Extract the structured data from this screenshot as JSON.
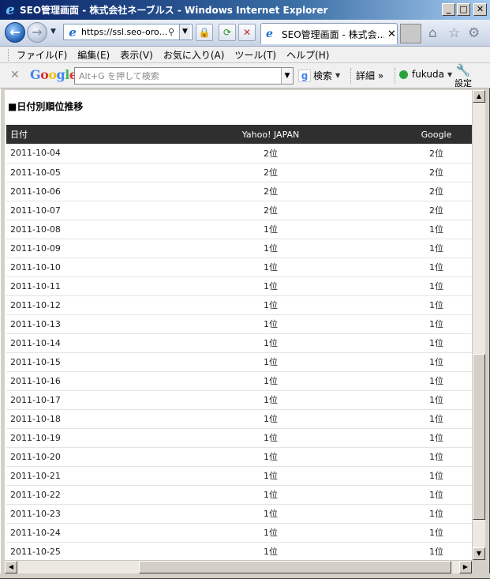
{
  "window": {
    "title": "SEO管理画面 - 株式会社ネーブルス - Windows Internet Explorer",
    "logo_icon": "ie-logo-icon",
    "controls": {
      "minimize": "_",
      "maximize": "□",
      "close": "✕"
    }
  },
  "address": {
    "url": "https://ssl.seo-oro...",
    "lock_icon": "lock-icon",
    "refresh_icon": "refresh-icon",
    "stop_icon": "stop-icon"
  },
  "tab": {
    "title": "SEO管理画面 - 株式会...",
    "close": "✕"
  },
  "menu": [
    "ファイル(F)",
    "編集(E)",
    "表示(V)",
    "お気に入り(A)",
    "ツール(T)",
    "ヘルプ(H)"
  ],
  "google_toolbar": {
    "logo": "Google",
    "search_placeholder": "Alt+G を押して検索",
    "search_button": "検索",
    "details": "詳細 »",
    "user": "fukuda",
    "settings": "設定"
  },
  "page": {
    "section_title": "■日付別順位推移",
    "table": {
      "headers": {
        "date": "日付",
        "yahoo": "Yahoo! JAPAN",
        "google": "Google"
      },
      "rows": [
        {
          "date": "2011-10-04",
          "yahoo": "2位",
          "google": "2位"
        },
        {
          "date": "2011-10-05",
          "yahoo": "2位",
          "google": "2位"
        },
        {
          "date": "2011-10-06",
          "yahoo": "2位",
          "google": "2位"
        },
        {
          "date": "2011-10-07",
          "yahoo": "2位",
          "google": "2位"
        },
        {
          "date": "2011-10-08",
          "yahoo": "1位",
          "google": "1位"
        },
        {
          "date": "2011-10-09",
          "yahoo": "1位",
          "google": "1位"
        },
        {
          "date": "2011-10-10",
          "yahoo": "1位",
          "google": "1位"
        },
        {
          "date": "2011-10-11",
          "yahoo": "1位",
          "google": "1位"
        },
        {
          "date": "2011-10-12",
          "yahoo": "1位",
          "google": "1位"
        },
        {
          "date": "2011-10-13",
          "yahoo": "1位",
          "google": "1位"
        },
        {
          "date": "2011-10-14",
          "yahoo": "1位",
          "google": "1位"
        },
        {
          "date": "2011-10-15",
          "yahoo": "1位",
          "google": "1位"
        },
        {
          "date": "2011-10-16",
          "yahoo": "1位",
          "google": "1位"
        },
        {
          "date": "2011-10-17",
          "yahoo": "1位",
          "google": "1位"
        },
        {
          "date": "2011-10-18",
          "yahoo": "1位",
          "google": "1位"
        },
        {
          "date": "2011-10-19",
          "yahoo": "1位",
          "google": "1位"
        },
        {
          "date": "2011-10-20",
          "yahoo": "1位",
          "google": "1位"
        },
        {
          "date": "2011-10-21",
          "yahoo": "1位",
          "google": "1位"
        },
        {
          "date": "2011-10-22",
          "yahoo": "1位",
          "google": "1位"
        },
        {
          "date": "2011-10-23",
          "yahoo": "1位",
          "google": "1位"
        },
        {
          "date": "2011-10-24",
          "yahoo": "1位",
          "google": "1位"
        },
        {
          "date": "2011-10-25",
          "yahoo": "1位",
          "google": "1位"
        }
      ]
    }
  },
  "colors": {
    "table_header_bg": "#2f2f2f",
    "title_bar_start": "#0a246a",
    "title_bar_end": "#a6caf0"
  }
}
